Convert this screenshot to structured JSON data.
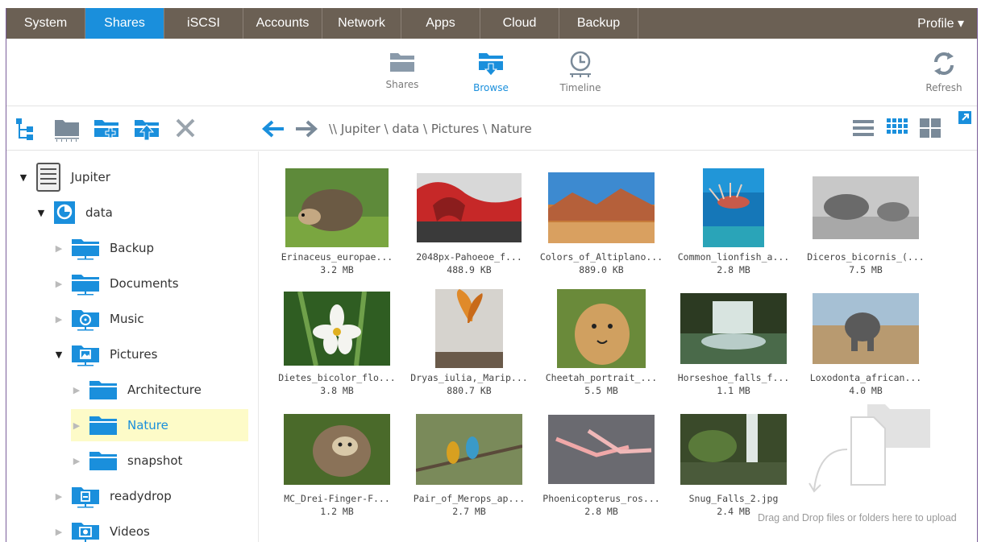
{
  "nav": {
    "tabs": [
      "System",
      "Shares",
      "iSCSI",
      "Accounts",
      "Network",
      "Apps",
      "Cloud",
      "Backup"
    ],
    "active": "Shares",
    "profile": "Profile ▾"
  },
  "subnav": {
    "shares": "Shares",
    "browse": "Browse",
    "timeline": "Timeline",
    "refresh": "Refresh",
    "active": "Browse"
  },
  "breadcrumb": {
    "prefix": "\\\\",
    "parts": [
      "Jupiter",
      "data",
      "Pictures",
      "Nature"
    ],
    "sep": "\\"
  },
  "tree": {
    "root": "Jupiter",
    "volume": "data",
    "folders": [
      "Backup",
      "Documents",
      "Music",
      "Pictures",
      "readydrop",
      "Videos"
    ],
    "pictures_children": [
      "Architecture",
      "Nature",
      "snapshot"
    ],
    "selected": "Nature"
  },
  "files": [
    {
      "name": "Erinaceus_europae...",
      "size": "3.2 MB"
    },
    {
      "name": "2048px-Pahoeoe_f...",
      "size": "488.9 KB"
    },
    {
      "name": "Colors_of_Altiplano...",
      "size": "889.0 KB"
    },
    {
      "name": "Common_lionfish_a...",
      "size": "2.8 MB"
    },
    {
      "name": "Diceros_bicornis_(...",
      "size": "7.5 MB"
    },
    {
      "name": "Dietes_bicolor_flo...",
      "size": "3.8 MB"
    },
    {
      "name": "Dryas_iulia,_Marip...",
      "size": "880.7 KB"
    },
    {
      "name": "Cheetah_portrait_...",
      "size": "5.5 MB"
    },
    {
      "name": "Horseshoe_falls_f...",
      "size": "1.1 MB"
    },
    {
      "name": "Loxodonta_african...",
      "size": "4.0 MB"
    },
    {
      "name": "MC_Drei-Finger-F...",
      "size": "1.2 MB"
    },
    {
      "name": "Pair_of_Merops_ap...",
      "size": "2.7 MB"
    },
    {
      "name": "Phoenicopterus_ros...",
      "size": "2.8 MB"
    },
    {
      "name": "Snug_Falls_2.jpg",
      "size": "2.4 MB"
    }
  ],
  "dropzone": "Drag and Drop files or folders here to upload",
  "colors": {
    "accent": "#1a8fdc",
    "navbar": "#6b6054",
    "selected_bg": "#fdfbc8"
  }
}
